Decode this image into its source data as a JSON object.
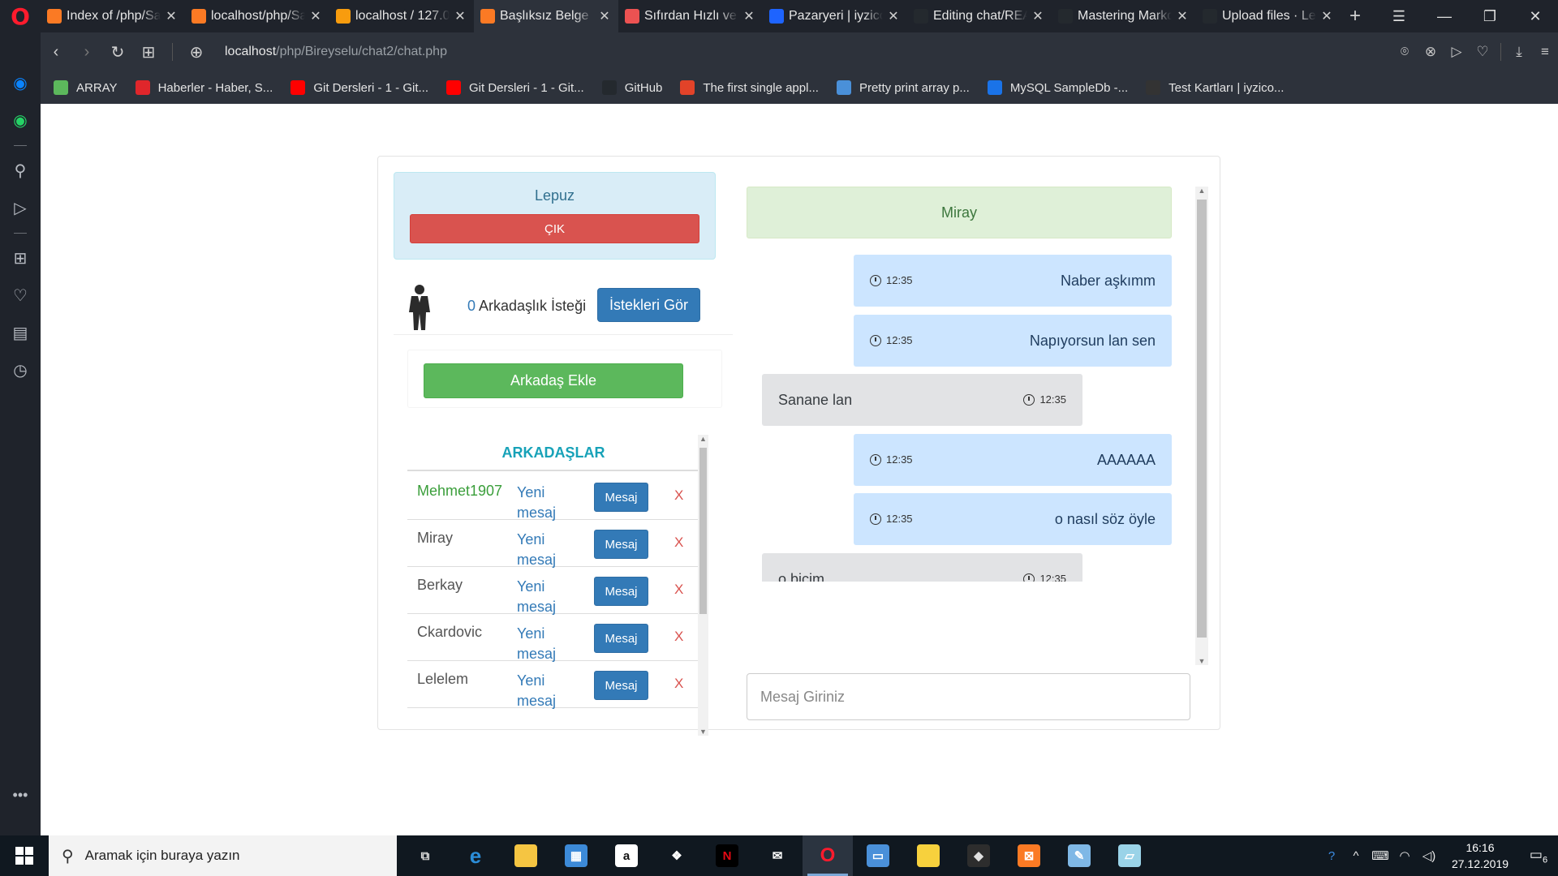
{
  "browser": {
    "tabs": [
      {
        "title": "Index of /php/Sa",
        "icon": "xampp-icon",
        "color": "#fb7a24",
        "active": false
      },
      {
        "title": "localhost/php/Sa",
        "icon": "xampp-icon",
        "color": "#fb7a24",
        "active": false
      },
      {
        "title": "localhost / 127.0",
        "icon": "phpmyadmin-icon",
        "color": "#f89c0e",
        "active": false
      },
      {
        "title": "Başlıksız Belge",
        "icon": "xampp-icon",
        "color": "#fb7a24",
        "active": true
      },
      {
        "title": "Sıfırdan Hızlı ve",
        "icon": "udemy-icon",
        "color": "#ec5252",
        "active": false
      },
      {
        "title": "Pazaryeri | iyzico",
        "icon": "iyzico-icon",
        "color": "#1e64ff",
        "active": false
      },
      {
        "title": "Editing chat/REA",
        "icon": "github-icon",
        "color": "#24292e",
        "active": false
      },
      {
        "title": "Mastering Markd",
        "icon": "github-icon",
        "color": "#24292e",
        "active": false
      },
      {
        "title": "Upload files · Lep",
        "icon": "github-icon",
        "color": "#24292e",
        "active": false
      }
    ],
    "url_host": "localhost",
    "url_path": "/php/Bireyselu/chat2/chat.php",
    "bookmarks": [
      {
        "label": "ARRAY",
        "icon": "array-icon",
        "color": "#5cb85c"
      },
      {
        "label": "Haberler - Haber, S...",
        "icon": "haberler-icon",
        "color": "#e0262b"
      },
      {
        "label": "Git Dersleri - 1 - Git...",
        "icon": "youtube-icon",
        "color": "#ff0000"
      },
      {
        "label": "Git Dersleri - 1 - Git...",
        "icon": "youtube-icon",
        "color": "#ff0000"
      },
      {
        "label": "GitHub",
        "icon": "github-icon",
        "color": "#24292e"
      },
      {
        "label": "The first single appl...",
        "icon": "gitlab-icon",
        "color": "#e24329"
      },
      {
        "label": "Pretty print array p...",
        "icon": "dots-icon",
        "color": "#4a90d9"
      },
      {
        "label": "MySQL SampleDb -...",
        "icon": "mysql-icon",
        "color": "#1a73e8"
      },
      {
        "label": "Test Kartları | iyzico...",
        "icon": "iyzico-icon",
        "color": "#333333"
      }
    ]
  },
  "user": {
    "name": "Lepuz",
    "exit_label": "ÇIK"
  },
  "requests": {
    "count": "0",
    "label": " Arkadaşlık İsteği",
    "button": "İstekleri Gör"
  },
  "add_friend_label": "Arkadaş Ekle",
  "friends": {
    "title": "ARKADAŞLAR",
    "message_label": "Mesaj",
    "delete_label": "X",
    "new_label": "Yeni mesaj",
    "items": [
      {
        "name": "Mehmet1907",
        "online": true
      },
      {
        "name": "Miray",
        "online": false
      },
      {
        "name": "Berkay",
        "online": false
      },
      {
        "name": "Ckardovic",
        "online": false
      },
      {
        "name": "Lelelem",
        "online": false
      }
    ]
  },
  "chat": {
    "partner": "Miray",
    "messages": [
      {
        "text": "Naber aşkımm",
        "time": "12:35",
        "mine": true
      },
      {
        "text": "Napıyorsun lan sen",
        "time": "12:35",
        "mine": true
      },
      {
        "text": "Sanane lan",
        "time": "12:35",
        "mine": false
      },
      {
        "text": "AAAAAA",
        "time": "12:35",
        "mine": true
      },
      {
        "text": "o nasıl söz öyle",
        "time": "12:35",
        "mine": true
      },
      {
        "text": "o biçim",
        "time": "12:35",
        "mine": false
      }
    ],
    "input_placeholder": "Mesaj Giriniz"
  },
  "taskbar": {
    "search_placeholder": "Aramak için buraya yazın",
    "time": "16:16",
    "date": "27.12.2019",
    "notifications": "6"
  }
}
